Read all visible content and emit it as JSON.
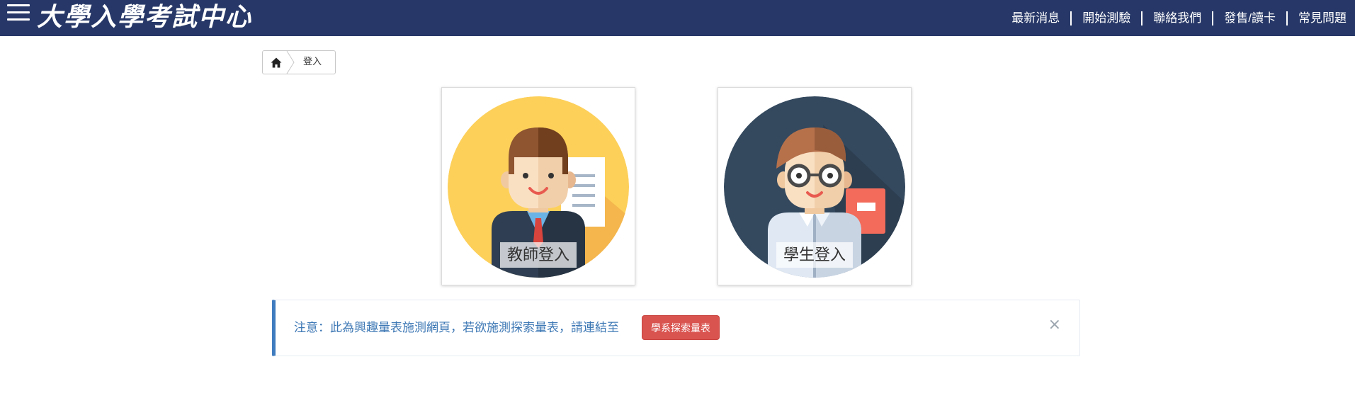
{
  "header": {
    "logo_text": "大學入學考試中心",
    "nav": [
      {
        "label": "最新消息"
      },
      {
        "label": "開始測驗"
      },
      {
        "label": "聯絡我們"
      },
      {
        "label": "發售/讀卡"
      },
      {
        "label": "常見問題"
      }
    ],
    "background_color": "#273868"
  },
  "breadcrumb": {
    "home_icon": "home-icon",
    "current": "登入"
  },
  "login_cards": {
    "teacher": {
      "label": "教師登入",
      "icon": "teacher-avatar-icon",
      "circle_color": "#fdd05a"
    },
    "student": {
      "label": "學生登入",
      "icon": "student-avatar-icon",
      "circle_color": "#34495e"
    }
  },
  "alert": {
    "message": "注意：此為興趣量表施測網頁，若欲施測探索量表，請連結至",
    "button_label": "學系探索量表",
    "close_symbol": "×",
    "accent_color": "#3f7cbf",
    "button_color": "#d9534f"
  }
}
